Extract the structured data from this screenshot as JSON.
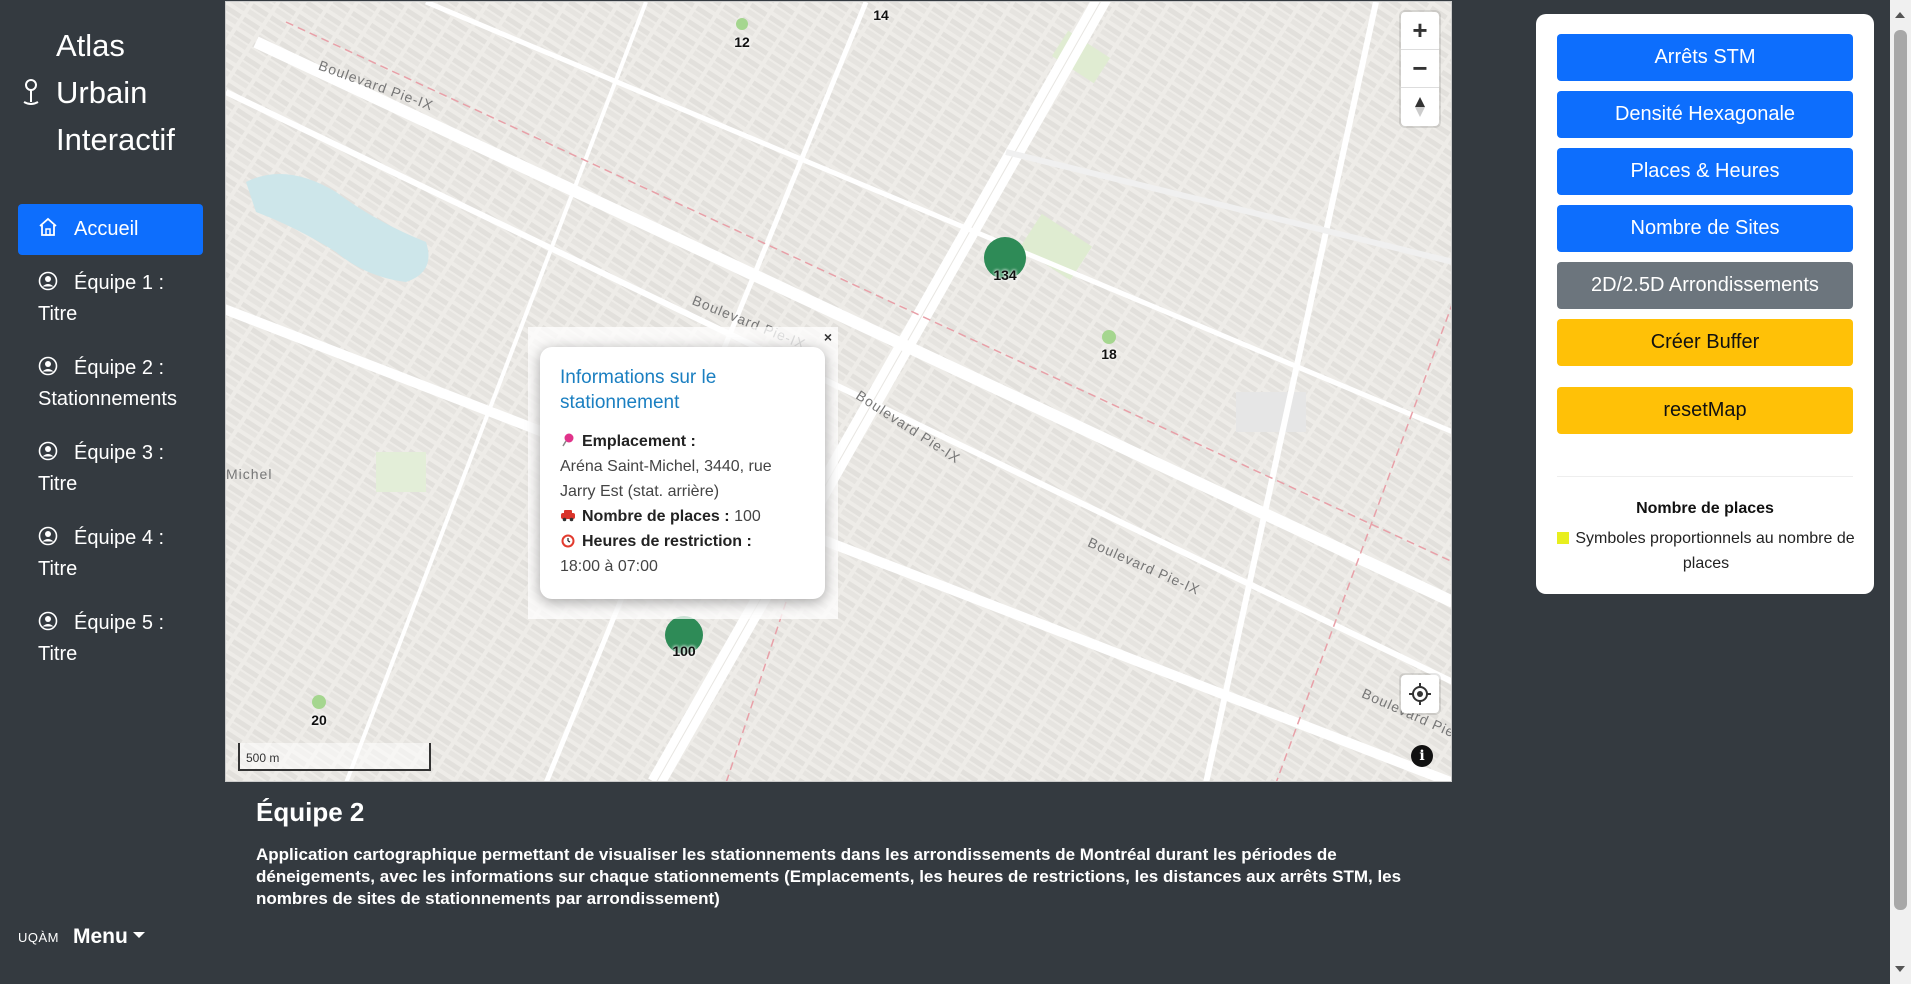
{
  "sidebar": {
    "brand": {
      "line1": "Atlas",
      "line2": "Urbain",
      "line3": "Interactif",
      "icon": "map-pin-icon"
    },
    "nav": [
      {
        "line1": "Accueil",
        "line2": "",
        "icon": "home-icon",
        "active": true
      },
      {
        "line1": "Équipe 1 :",
        "line2": "Titre",
        "icon": "user-circle-icon"
      },
      {
        "line1": "Équipe 2 :",
        "line2": "Stationnements",
        "icon": "user-circle-icon"
      },
      {
        "line1": "Équipe 3 :",
        "line2": "Titre",
        "icon": "user-circle-icon"
      },
      {
        "line1": "Équipe 4 :",
        "line2": "Titre",
        "icon": "user-circle-icon"
      },
      {
        "line1": "Équipe 5 :",
        "line2": "Titre",
        "icon": "user-circle-icon"
      }
    ],
    "logo": "UQÀM",
    "menu_label": "Menu"
  },
  "map": {
    "scale_label": "500 m",
    "markers": [
      {
        "value": "12",
        "size": "small"
      },
      {
        "value": "14",
        "size": "small"
      },
      {
        "value": "134",
        "size": "large"
      },
      {
        "value": "18",
        "size": "small"
      },
      {
        "value": "100",
        "size": "large"
      },
      {
        "value": "20",
        "size": "small"
      }
    ],
    "street_labels": [
      "Boulevard Pie-IX",
      "Boulevard Pie-IX",
      "Boulevard Pie-IX",
      "Boulevard Pie-IX",
      "Boulevard Pie-IX",
      "Michel"
    ],
    "popup": {
      "close": "×",
      "title": "Informations sur le stationnement",
      "emplacement_label": "Emplacement :",
      "emplacement_value": "Aréna Saint-Michel, 3440, rue Jarry Est (stat. arrière)",
      "places_label": "Nombre de places :",
      "places_value": "100",
      "heures_label": "Heures de restriction :",
      "heures_value": "18:00 à 07:00"
    },
    "controls": {
      "zoom_in": "+",
      "zoom_out": "−",
      "info": "i"
    },
    "colors": {
      "marker": "#2e8b57",
      "marker_light": "#a5d68f"
    }
  },
  "panel": {
    "buttons": [
      {
        "label": "Arrêts STM",
        "style": "blue"
      },
      {
        "label": "Densité Hexagonale",
        "style": "blue"
      },
      {
        "label": "Places & Heures",
        "style": "blue"
      },
      {
        "label": "Nombre de Sites",
        "style": "blue"
      },
      {
        "label": "2D/2.5D Arrondissements",
        "style": "gray"
      },
      {
        "label": "Créer Buffer",
        "style": "yellow"
      },
      {
        "label": "resetMap",
        "style": "yellow"
      }
    ],
    "legend": {
      "title": "Nombre de places",
      "item": "Symboles proportionnels au nombre de places",
      "swatch_color": "#e8ef1f"
    }
  },
  "description": {
    "title": "Équipe 2",
    "text": "Application cartographique permettant de visualiser les stationnements dans les arrondissements de Montréal durant les périodes de déneigements, avec les informations sur chaque stationnements (Emplacements, les heures de restrictions, les distances aux arrêts STM, les nombres de sites de stationnements par arrondissement)"
  }
}
